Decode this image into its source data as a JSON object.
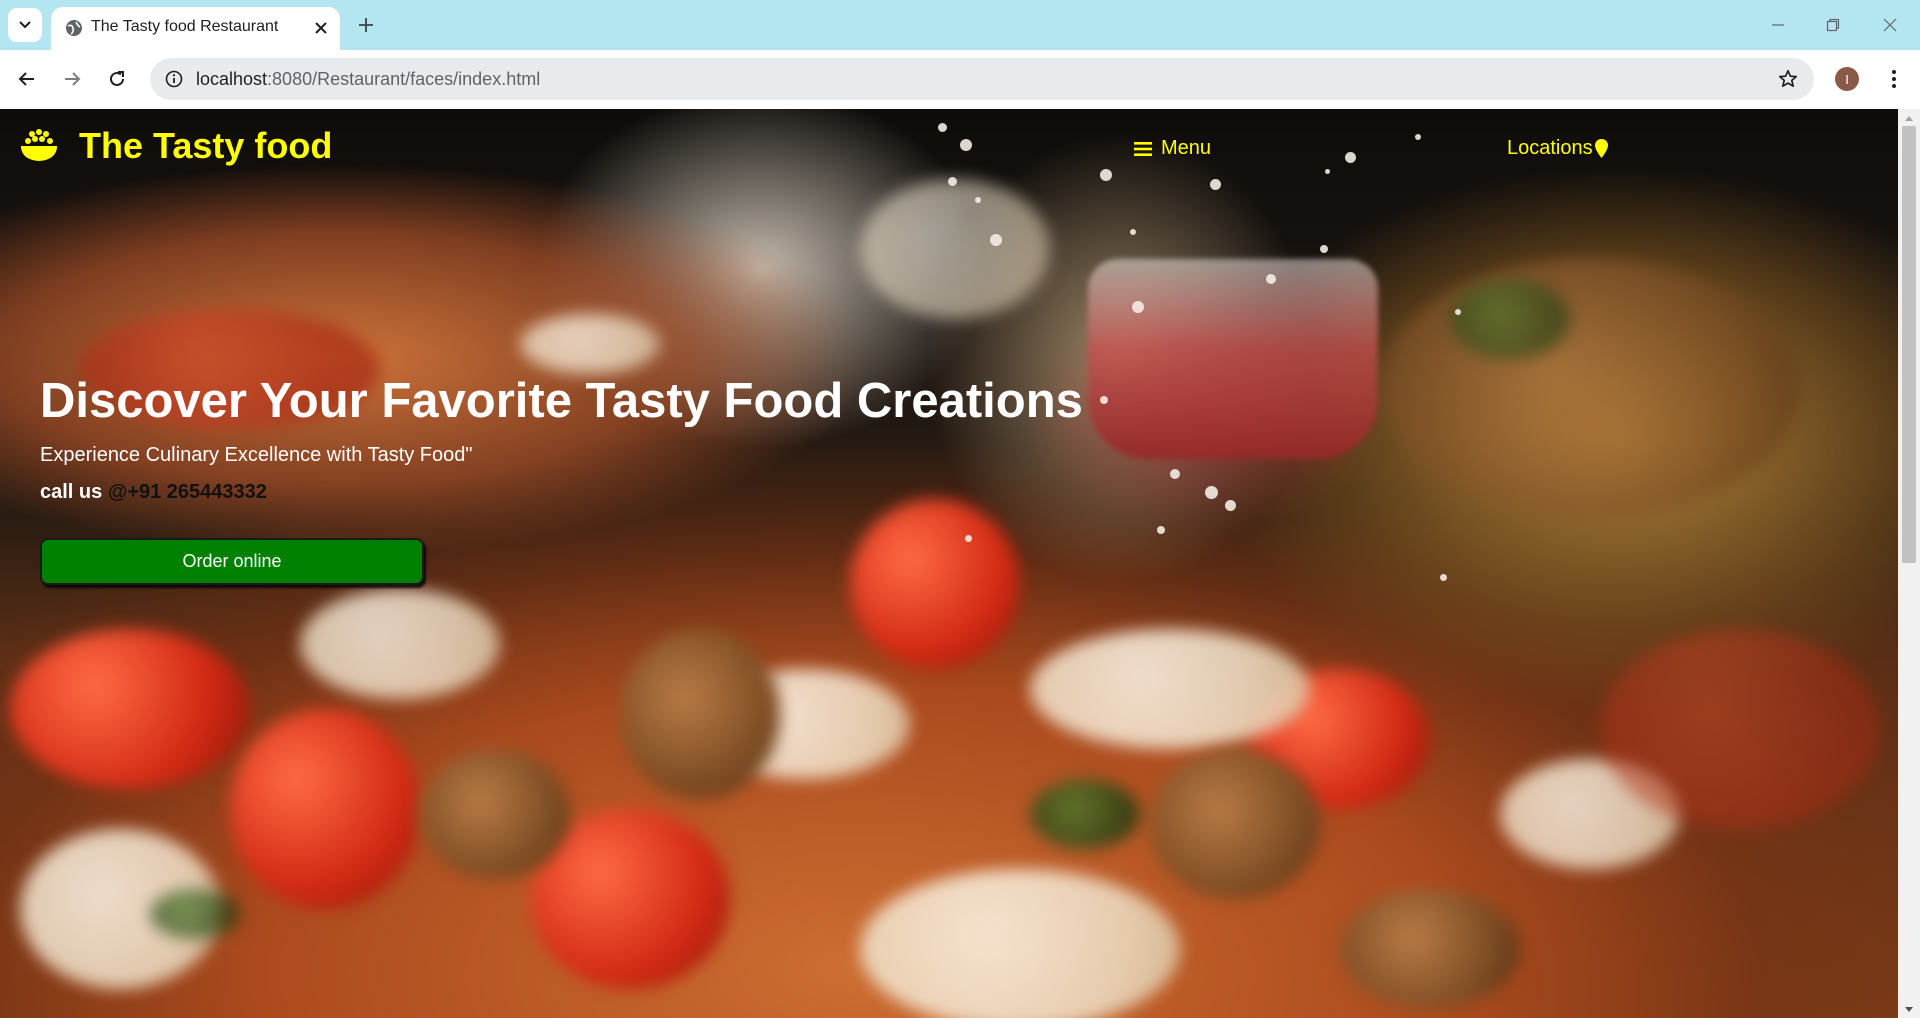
{
  "browser": {
    "tab": {
      "title": "The Tasty food Restaurant"
    },
    "url": {
      "host": "localhost",
      "path": ":8080/Restaurant/faces/index.html"
    },
    "profile_initial": "I",
    "icons": {
      "tab_list": "chevron-down-icon",
      "favicon": "globe-icon",
      "tab_close": "close-icon",
      "new_tab": "plus-icon",
      "minimize": "minimize-icon",
      "restore": "restore-icon",
      "close_window": "close-icon",
      "back": "arrow-left-icon",
      "forward": "arrow-right-icon",
      "reload": "reload-icon",
      "site_info": "info-icon",
      "bookmark": "star-icon",
      "menu": "kebab-icon"
    }
  },
  "page": {
    "brand": {
      "name": "The Tasty food",
      "icon": "food-bowl-icon"
    },
    "nav": {
      "menu_label": "Menu",
      "menu_icon": "hamburger-icon",
      "locations_label": "Locations",
      "locations_icon": "location-pin-icon"
    },
    "hero": {
      "title": "Discover Your Favorite Tasty Food Creations",
      "subtitle": "Experience Culinary Excellence with Tasty Food\"",
      "call_prefix": "call us ",
      "call_number": "@+91 265443332",
      "order_button": "Order online"
    },
    "colors": {
      "brand_yellow": "#ffff00",
      "order_button_green": "#008000",
      "tab_strip": "#b4e6f1"
    }
  }
}
